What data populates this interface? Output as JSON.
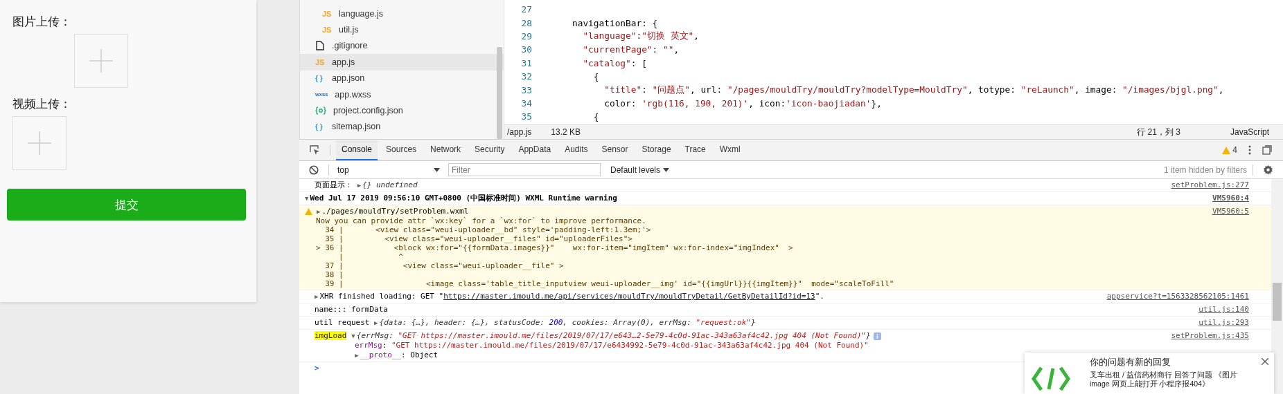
{
  "phone": {
    "image_label": "图片上传：",
    "video_label": "视频上传：",
    "submit": "提交"
  },
  "file_tree": [
    {
      "children": [
        {
          "name": "language.js",
          "kind": "js",
          "badge": "JS",
          "selected": false
        },
        {
          "name": "util.js",
          "kind": "js",
          "badge": "JS",
          "selected": false
        }
      ]
    },
    {
      "name": ".gitignore",
      "kind": "file",
      "selected": false
    },
    {
      "name": "app.js",
      "kind": "js",
      "badge": "JS",
      "selected": true
    },
    {
      "name": "app.json",
      "kind": "json",
      "badge": "{ }",
      "selected": false
    },
    {
      "name": "app.wxss",
      "kind": "wxss",
      "badge": "wxss",
      "selected": false
    },
    {
      "name": "project.config.json",
      "kind": "config",
      "selected": false
    },
    {
      "name": "sitemap.json",
      "kind": "json",
      "badge": "{ }",
      "selected": false
    }
  ],
  "editor": {
    "lines": [
      {
        "number": "27"
      },
      {
        "number": "28",
        "segments": [
          {
            "text": "navigationBar: {",
            "kind": "plain"
          }
        ],
        "children": [
          {
            "number": "29",
            "segments": [
              {
                "text": "\"language\"",
                "kind": "str"
              },
              {
                "text": ":",
                "kind": "plain"
              },
              {
                "text": "\"切换 英文\"",
                "kind": "str"
              },
              {
                "text": ",",
                "kind": "plain"
              }
            ]
          },
          {
            "number": "30",
            "segments": [
              {
                "text": "\"currentPage\"",
                "kind": "str"
              },
              {
                "text": ": ",
                "kind": "plain"
              },
              {
                "text": "\"\"",
                "kind": "str"
              },
              {
                "text": ",",
                "kind": "plain"
              }
            ]
          },
          {
            "number": "31",
            "segments": [
              {
                "text": "\"catalog\"",
                "kind": "str"
              },
              {
                "text": ": [",
                "kind": "plain"
              }
            ],
            "children": [
              {
                "number": "32",
                "segments": [
                  {
                    "text": "{",
                    "kind": "plain"
                  }
                ],
                "children": [
                  {
                    "number": "33",
                    "segments": [
                      {
                        "text": "\"title\"",
                        "kind": "str"
                      },
                      {
                        "text": ": ",
                        "kind": "plain"
                      },
                      {
                        "text": "\"问题点\"",
                        "kind": "str"
                      },
                      {
                        "text": ", url: ",
                        "kind": "plain"
                      },
                      {
                        "text": "\"/pages/mouldTry/mouldTry?modelType=MouldTry\"",
                        "kind": "str"
                      },
                      {
                        "text": ", totype: ",
                        "kind": "plain"
                      },
                      {
                        "text": "\"reLaunch\"",
                        "kind": "str"
                      },
                      {
                        "text": ", image: ",
                        "kind": "plain"
                      },
                      {
                        "text": "\"/images/bjgl.png\"",
                        "kind": "str"
                      },
                      {
                        "text": ",",
                        "kind": "plain"
                      }
                    ]
                  },
                  {
                    "number": "34",
                    "segments": [
                      {
                        "text": "color: ",
                        "kind": "plain"
                      },
                      {
                        "text": "'rgb(116, 190, 201)'",
                        "kind": "str"
                      },
                      {
                        "text": ", icon:",
                        "kind": "plain"
                      },
                      {
                        "text": "'icon-baojiadan'",
                        "kind": "str"
                      },
                      {
                        "text": "},",
                        "kind": "plain"
                      }
                    ]
                  }
                ]
              },
              {
                "number": "35",
                "segments": [
                  {
                    "text": "{",
                    "kind": "plain"
                  }
                ]
              }
            ]
          }
        ]
      }
    ],
    "status": {
      "path": "/app.js",
      "size": "13.2 KB",
      "position": "行 21，列 3",
      "language": "JavaScript"
    }
  },
  "devtools": {
    "tabs": [
      {
        "label": "Console",
        "selected": true
      },
      {
        "label": "Sources",
        "selected": false
      },
      {
        "label": "Network",
        "selected": false
      },
      {
        "label": "Security",
        "selected": false
      },
      {
        "label": "AppData",
        "selected": false
      },
      {
        "label": "Audits",
        "selected": false
      },
      {
        "label": "Sensor",
        "selected": false
      },
      {
        "label": "Storage",
        "selected": false
      },
      {
        "label": "Trace",
        "selected": false
      },
      {
        "label": "Wxml",
        "selected": false
      }
    ],
    "warning_count": "4",
    "context": "top",
    "filter_placeholder": "Filter",
    "levels": "Default levels",
    "hidden_note": "1 item hidden by filters"
  },
  "console": [
    {
      "kind": "log",
      "segments": [
        {
          "text": "页面显示： ",
          "kind": "plain"
        },
        {
          "text": "▶",
          "kind": "caret"
        },
        {
          "text": "{} undefined",
          "kind": "obj"
        }
      ],
      "source": "setProblem.js:277"
    },
    {
      "kind": "group",
      "segments": [
        {
          "text": "▼",
          "kind": "caret"
        },
        {
          "text": "Wed Jul 17 2019 09:56:10 GMT+0800 (中国标准时间) WXML Runtime warning",
          "kind": "plain"
        }
      ],
      "source": "VM5960:4"
    },
    {
      "kind": "warning",
      "segments": [
        {
          "text": "▶",
          "kind": "caret"
        },
        {
          "text": "./pages/mouldTry/setProblem.wxml",
          "kind": "plain"
        }
      ],
      "message": "Now you can provide attr `wx:key` for a `wx:for` to improve performance.",
      "code": [
        "  34 |       <view class=\"weui-uploader__bd\" style='padding-left:1.3em;'>",
        "  35 |         <view class=\"weui-uploader__files\" id=\"uploaderFiles\">",
        "> 36 |           <block wx:for=\"{{formData.images}}\"    wx:for-item=\"imgItem\" wx:for-index=\"imgIndex\"  >",
        "     |            ^",
        "  37 |             <view class=\"weui-uploader__file\" >",
        "  38 |",
        "  39 |                  <image class='table_title_inputview weui-uploader__img' id=\"{{imgUrl}}{{imgItem}}\"  mode=\"scaleToFill\""
      ],
      "source": "VM5960:5"
    },
    {
      "kind": "log",
      "segments": [
        {
          "text": "▶",
          "kind": "caret"
        },
        {
          "text": "XHR finished loading: GET \"",
          "kind": "plain"
        },
        {
          "text": "https://master.imould.me/api/services/mouldTry/mouldTryDetail/GetByDetailId?id=13",
          "kind": "link"
        },
        {
          "text": "\".",
          "kind": "plain"
        }
      ],
      "source": "appservice?t=1563328562105:1461"
    },
    {
      "kind": "log",
      "segments": [
        {
          "text": "name::: formData",
          "kind": "plain"
        }
      ],
      "source": "util.js:140"
    },
    {
      "kind": "log",
      "segments": [
        {
          "text": "util request ",
          "kind": "plain"
        },
        {
          "text": "▶",
          "kind": "caret"
        },
        {
          "text": "{data: {…}, header: {…}, statusCode: ",
          "kind": "obj"
        },
        {
          "text": "200",
          "kind": "num"
        },
        {
          "text": ", cookies: Array(0), errMsg: ",
          "kind": "obj"
        },
        {
          "text": "\"request:ok\"",
          "kind": "objstr"
        },
        {
          "text": "}",
          "kind": "obj"
        }
      ],
      "source": "util.js:293"
    },
    {
      "kind": "log",
      "segments": [
        {
          "text": "imgLoad",
          "kind": "highlight"
        },
        {
          "text": "▼",
          "kind": "caret"
        },
        {
          "text": "{errMsg: ",
          "kind": "obj"
        },
        {
          "text": "\"GET https://master.imould.me/files/2019/07/17/e643…2-5e79-4c0d-91ac-343a63af4c42.jpg 404 (Not Found)\"",
          "kind": "objstr"
        },
        {
          "text": "}",
          "kind": "obj"
        }
      ],
      "info_badge": true,
      "details": [
        [
          {
            "text": "errMsg",
            "kind": "key"
          },
          {
            "text": ": ",
            "kind": "plain"
          },
          {
            "text": "\"GET https://master.imould.me/files/2019/07/17/e6434992-5e79-4c0d-91ac-343a63af4c42.jpg 404 (Not Found)\"",
            "kind": "str"
          }
        ],
        [
          {
            "text": "▶",
            "kind": "caret"
          },
          {
            "text": "__proto__",
            "kind": "key"
          },
          {
            "text": ": Object",
            "kind": "plain"
          }
        ]
      ],
      "source": "setProblem.js:435"
    }
  ],
  "prompt": ">",
  "notification": {
    "title": "你的问题有新的回复",
    "body": "叉车出租 / 益信药材商行 回答了问题 《图片image 网页上能打开 小程序报404》"
  }
}
